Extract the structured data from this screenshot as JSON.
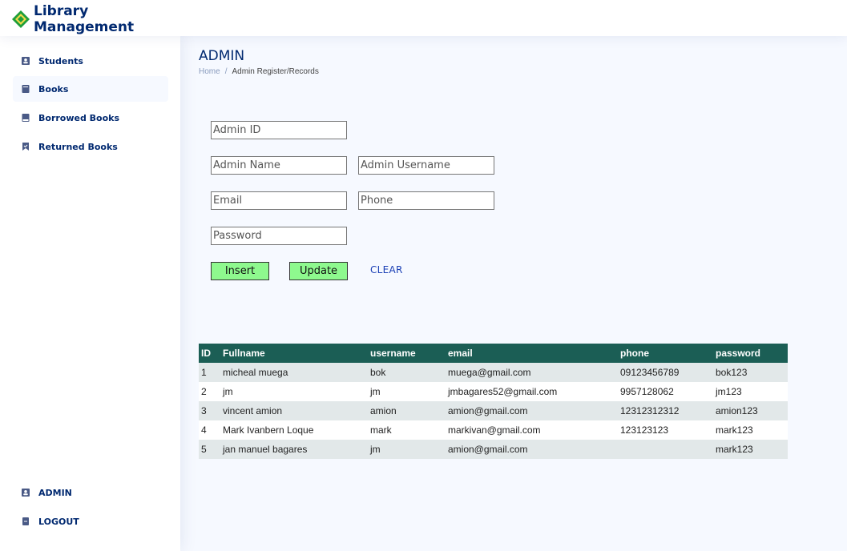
{
  "app": {
    "title_line1": "Library",
    "title_line2": "Management"
  },
  "sidebar": {
    "items": [
      {
        "label": "Students",
        "icon": "students-icon"
      },
      {
        "label": "Books",
        "icon": "book-icon"
      },
      {
        "label": "Borrowed Books",
        "icon": "borrowed-book-icon"
      },
      {
        "label": "Returned Books",
        "icon": "bookmark-icon"
      }
    ],
    "bottom_items": [
      {
        "label": "ADMIN",
        "icon": "admin-icon"
      },
      {
        "label": "LOGOUT",
        "icon": "logout-icon"
      }
    ]
  },
  "page": {
    "title": "ADMIN",
    "breadcrumb": [
      "Home",
      "Admin Register/Records"
    ]
  },
  "form": {
    "admin_id_placeholder": "Admin ID",
    "admin_name_placeholder": "Admin Name",
    "admin_username_placeholder": "Admin Username",
    "email_placeholder": "Email",
    "phone_placeholder": "Phone",
    "password_placeholder": "Password",
    "insert_label": "Insert",
    "update_label": "Update",
    "clear_label": "CLEAR"
  },
  "table": {
    "headers": [
      "ID",
      "Fullname",
      "username",
      "email",
      "phone",
      "password"
    ],
    "rows": [
      [
        "1",
        "micheal muega",
        "bok",
        "muega@gmail.com",
        "09123456789",
        "bok123"
      ],
      [
        "2",
        "jm",
        "jm",
        "jmbagares52@gmail.com",
        "9957128062",
        "jm123"
      ],
      [
        "3",
        "vincent amion",
        "amion",
        "amion@gmail.com",
        "12312312312",
        "amion123"
      ],
      [
        "4",
        "Mark Ivanbern Loque",
        "mark",
        "markivan@gmail.com",
        "123123123",
        "mark123"
      ],
      [
        "5",
        "jan manuel bagares",
        "jm",
        "amion@gmail.com",
        "",
        "mark123"
      ]
    ]
  },
  "colors": {
    "brand": "#012970",
    "table_header": "#1b5e55",
    "button": "#8ef98e",
    "logo_green": "#1e9e3a"
  }
}
